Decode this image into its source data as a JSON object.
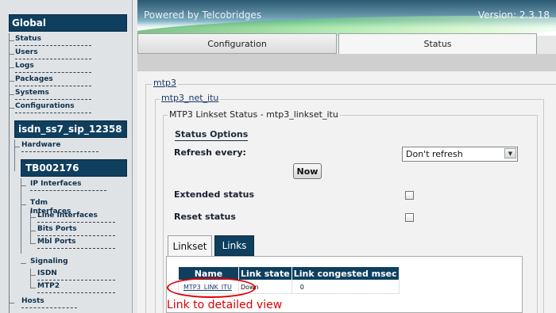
{
  "sidebar": {
    "global_title": "Global",
    "global_items": [
      "Status",
      "Users",
      "Logs",
      "Packages",
      "Systems",
      "Configurations"
    ],
    "node_title": "isdn_ss7_sip_12358",
    "hardware_label": "Hardware",
    "unit_title": "TB002176",
    "ip_interfaces_label": "IP Interfaces",
    "tdm_interfaces_label": "Tdm Interfaces",
    "tdm_items": [
      "Line Interfaces",
      "Bits Ports",
      "Mbl Ports"
    ],
    "signaling_label": "Signaling",
    "signaling_items": [
      "ISDN",
      "MTP2"
    ],
    "hosts_label": "Hosts"
  },
  "header": {
    "powered": "Powered by Telcobridges",
    "version": "Version: 2.3.18"
  },
  "tabs": {
    "configuration": "Configuration",
    "status": "Status",
    "active": "Status"
  },
  "breadcrumbs": {
    "mtp3": "mtp3",
    "mtp3_net": "mtp3_net_itu",
    "linkset_status": "MTP3 Linkset Status - mtp3_linkset_itu"
  },
  "status_options": {
    "title": "Status Options",
    "refresh_label": "Refresh every:",
    "refresh_value": "Don't refresh",
    "now_button": "Now",
    "extended_label": "Extended status",
    "extended_checked": false,
    "reset_label": "Reset status",
    "reset_checked": false
  },
  "subtabs": {
    "linkset": "Linkset",
    "links": "Links",
    "active": "Links"
  },
  "links_table": {
    "headers": [
      "Name",
      "Link state",
      "Link congested msec"
    ],
    "rows": [
      {
        "name": "MTP3_LINK_ITU",
        "state": "Down",
        "congested": "0"
      }
    ]
  },
  "annotation": {
    "callout_text": "Link to detailed view",
    "color": "#dd0000"
  },
  "colors": {
    "accent": "#0f3f5f",
    "sidebar_bg": "#dfe3e6",
    "content_bg": "#f2f2f2"
  }
}
